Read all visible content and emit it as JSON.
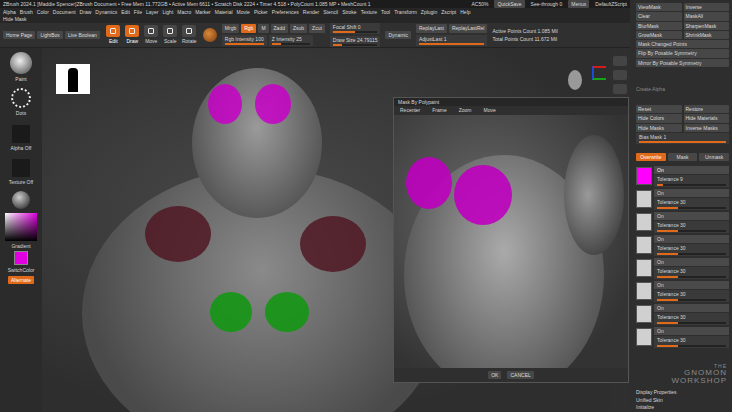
{
  "title_bar": {
    "text": "ZBrush 2024.1 [Maddie Spencer]ZBrush Document  • Free Mem 11.772GB • Active Mem 6611 • Scratch Disk 2224 • Timer 4.518 • PolyCount 1.085 MP • MeshCount 1",
    "items": [
      "AC50%",
      "QuickSave",
      "See-through 0",
      "Menus",
      "DefaultZScript"
    ]
  },
  "menu": [
    "Alpha",
    "Brush",
    "Color",
    "Document",
    "Draw",
    "Dynamics",
    "Edit",
    "File",
    "Layer",
    "Light",
    "Macro",
    "Marker",
    "Material",
    "Movie",
    "Picker",
    "Preferences",
    "Render",
    "Stencil",
    "Stroke",
    "Texture",
    "Tool",
    "Transform",
    "Zplugin",
    "Zscript",
    "Help"
  ],
  "sub_menu": "Hide Mask",
  "shelf": {
    "nav": [
      "Home Page",
      "LightBox",
      "Live Boolean"
    ],
    "tools": [
      {
        "label": "Edit",
        "selected": true
      },
      {
        "label": "Draw",
        "selected": true
      },
      {
        "label": "Move",
        "selected": false
      },
      {
        "label": "Scale",
        "selected": false
      },
      {
        "label": "Rotate",
        "selected": false
      }
    ],
    "rgb_modes": [
      {
        "label": "Mrgb",
        "selected": false
      },
      {
        "label": "Rgb",
        "selected": true
      },
      {
        "label": "M",
        "selected": false
      }
    ],
    "z_modes": [
      {
        "label": "Zadd",
        "selected": false
      },
      {
        "label": "Zsub",
        "selected": false
      },
      {
        "label": "Zcut",
        "selected": false
      }
    ],
    "intensity": [
      {
        "label": "Rgb Intensity 100",
        "level": 1.0
      },
      {
        "label": "Z Intensity 25",
        "level": 0.25
      }
    ],
    "draw": [
      {
        "label": "Focal Shift 0",
        "level": 0.5
      },
      {
        "label": "Draw Size 24.79115",
        "level": 0.2
      }
    ],
    "dynamic": "Dynamic",
    "replay": [
      "ReplayLast",
      "ReplayLastRel"
    ],
    "adjust": {
      "label": "AdjustLast 1",
      "level": 1.0
    },
    "stats": [
      "Active Points Count 1.085 Mil",
      "Total Points Count 11.672 Mil"
    ]
  },
  "left": {
    "brush": "Paint",
    "stroke": "Dots",
    "alpha": "Alpha Off",
    "texture": "Texture Off",
    "gradient": "Gradient",
    "switch": "SwitchColor",
    "alternate": "Alternate",
    "main_color": "#e000e0"
  },
  "dialog": {
    "title": "Mask By Polypaint",
    "tools": [
      "Recenter",
      "Frame",
      "Zoom",
      "Move"
    ],
    "buttons": [
      "OK",
      "CANCEL"
    ]
  },
  "tray": {
    "mask_buttons": [
      [
        "ViewMask",
        "Inverse"
      ],
      [
        "Clear",
        "MaskAll"
      ],
      [
        "BlurMask",
        "SharpenMask"
      ],
      [
        "GrowMask",
        "ShrinkMask"
      ]
    ],
    "mask_wide": [
      "Mask Changed Points",
      "Flip By Posable Symmetry",
      "Mirror By Posable Symmetry"
    ],
    "create_alpha": "Create Alpha",
    "pairs": [
      [
        "Reset",
        "Restore"
      ],
      [
        "Hide Colors",
        "Hide Materials"
      ],
      [
        "Hide Masks",
        "Inverse Masks"
      ]
    ],
    "bias": {
      "label": "Bias Mask 1",
      "level": 1.0
    },
    "tabs": [
      {
        "label": "Overwrite",
        "selected": true
      },
      {
        "label": "Mask",
        "selected": false
      },
      {
        "label": "Unmask",
        "selected": false
      }
    ],
    "entries": [
      {
        "on": "On",
        "tolerance": "Tolerance 9",
        "level": 0.09,
        "color": "#ff00ff",
        "selected": true
      },
      {
        "on": "On",
        "tolerance": "Tolerance 30",
        "level": 0.3,
        "color": "#d0d0d0",
        "selected": false
      },
      {
        "on": "On",
        "tolerance": "Tolerance 30",
        "level": 0.3,
        "color": "#d0d0d0",
        "selected": false
      },
      {
        "on": "On",
        "tolerance": "Tolerance 30",
        "level": 0.3,
        "color": "#d0d0d0",
        "selected": false
      },
      {
        "on": "On",
        "tolerance": "Tolerance 30",
        "level": 0.3,
        "color": "#d0d0d0",
        "selected": false
      },
      {
        "on": "On",
        "tolerance": "Tolerance 30",
        "level": 0.3,
        "color": "#d0d0d0",
        "selected": false
      },
      {
        "on": "On",
        "tolerance": "Tolerance 30",
        "level": 0.3,
        "color": "#d0d0d0",
        "selected": false
      },
      {
        "on": "On",
        "tolerance": "Tolerance 30",
        "level": 0.3,
        "color": "#d0d0d0",
        "selected": false
      }
    ],
    "footer": [
      "Display Properties",
      "Unified Skin",
      "Initialize"
    ]
  },
  "watermark": [
    "THE",
    "GNOMON",
    "WORKSHOP"
  ]
}
